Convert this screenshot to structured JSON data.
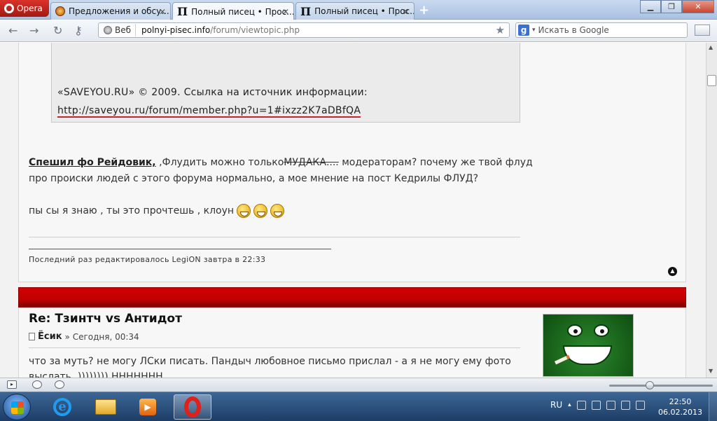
{
  "browser": {
    "menu_label": "Opera",
    "tabs": [
      {
        "label": "Предложения и обсу..."
      },
      {
        "label": "Полный писец • Прос..."
      },
      {
        "label": "Полный писец • Прос..."
      }
    ],
    "address": {
      "badge": "Веб",
      "host": "polnyi-pisec.info",
      "path": "/forum/viewtopic.php"
    },
    "search_placeholder": "Искать в Google"
  },
  "post1": {
    "quote_text": "«SAVEYOU.RU» © 2009. Ссылка на источник информации: ",
    "quote_link": "http://saveyou.ru/forum/member.php?u=1#ixzz2K7aDBfQA",
    "reply_author": "Спешил фо Рейдовик,",
    "reply_pre": " ,Флудить можно только",
    "reply_strike": "МУДАКА....",
    "reply_post": " модераторам? почему же твой флуд про происки людей с этого форума нормально, а мое мнение на пост Кедрилы ФЛУД?",
    "ps_text": "пы сы я знаю , ты это прочтешь , клоун",
    "edited_note": "Последний раз редактировалось LegiON завтра в 22:33"
  },
  "post2": {
    "title": "Re: Тзинтч vs Антидот",
    "author": "Ёсик",
    "meta": "» Сегодня, 00:34",
    "text": "что за муть? не могу ЛСки писать. Пандыч любовное письмо прислал - а я не могу ему фото выслать. )))))))) ННННННН"
  },
  "taskbar": {
    "lang": "RU",
    "time": "22:50",
    "date": "06.02.2013"
  }
}
